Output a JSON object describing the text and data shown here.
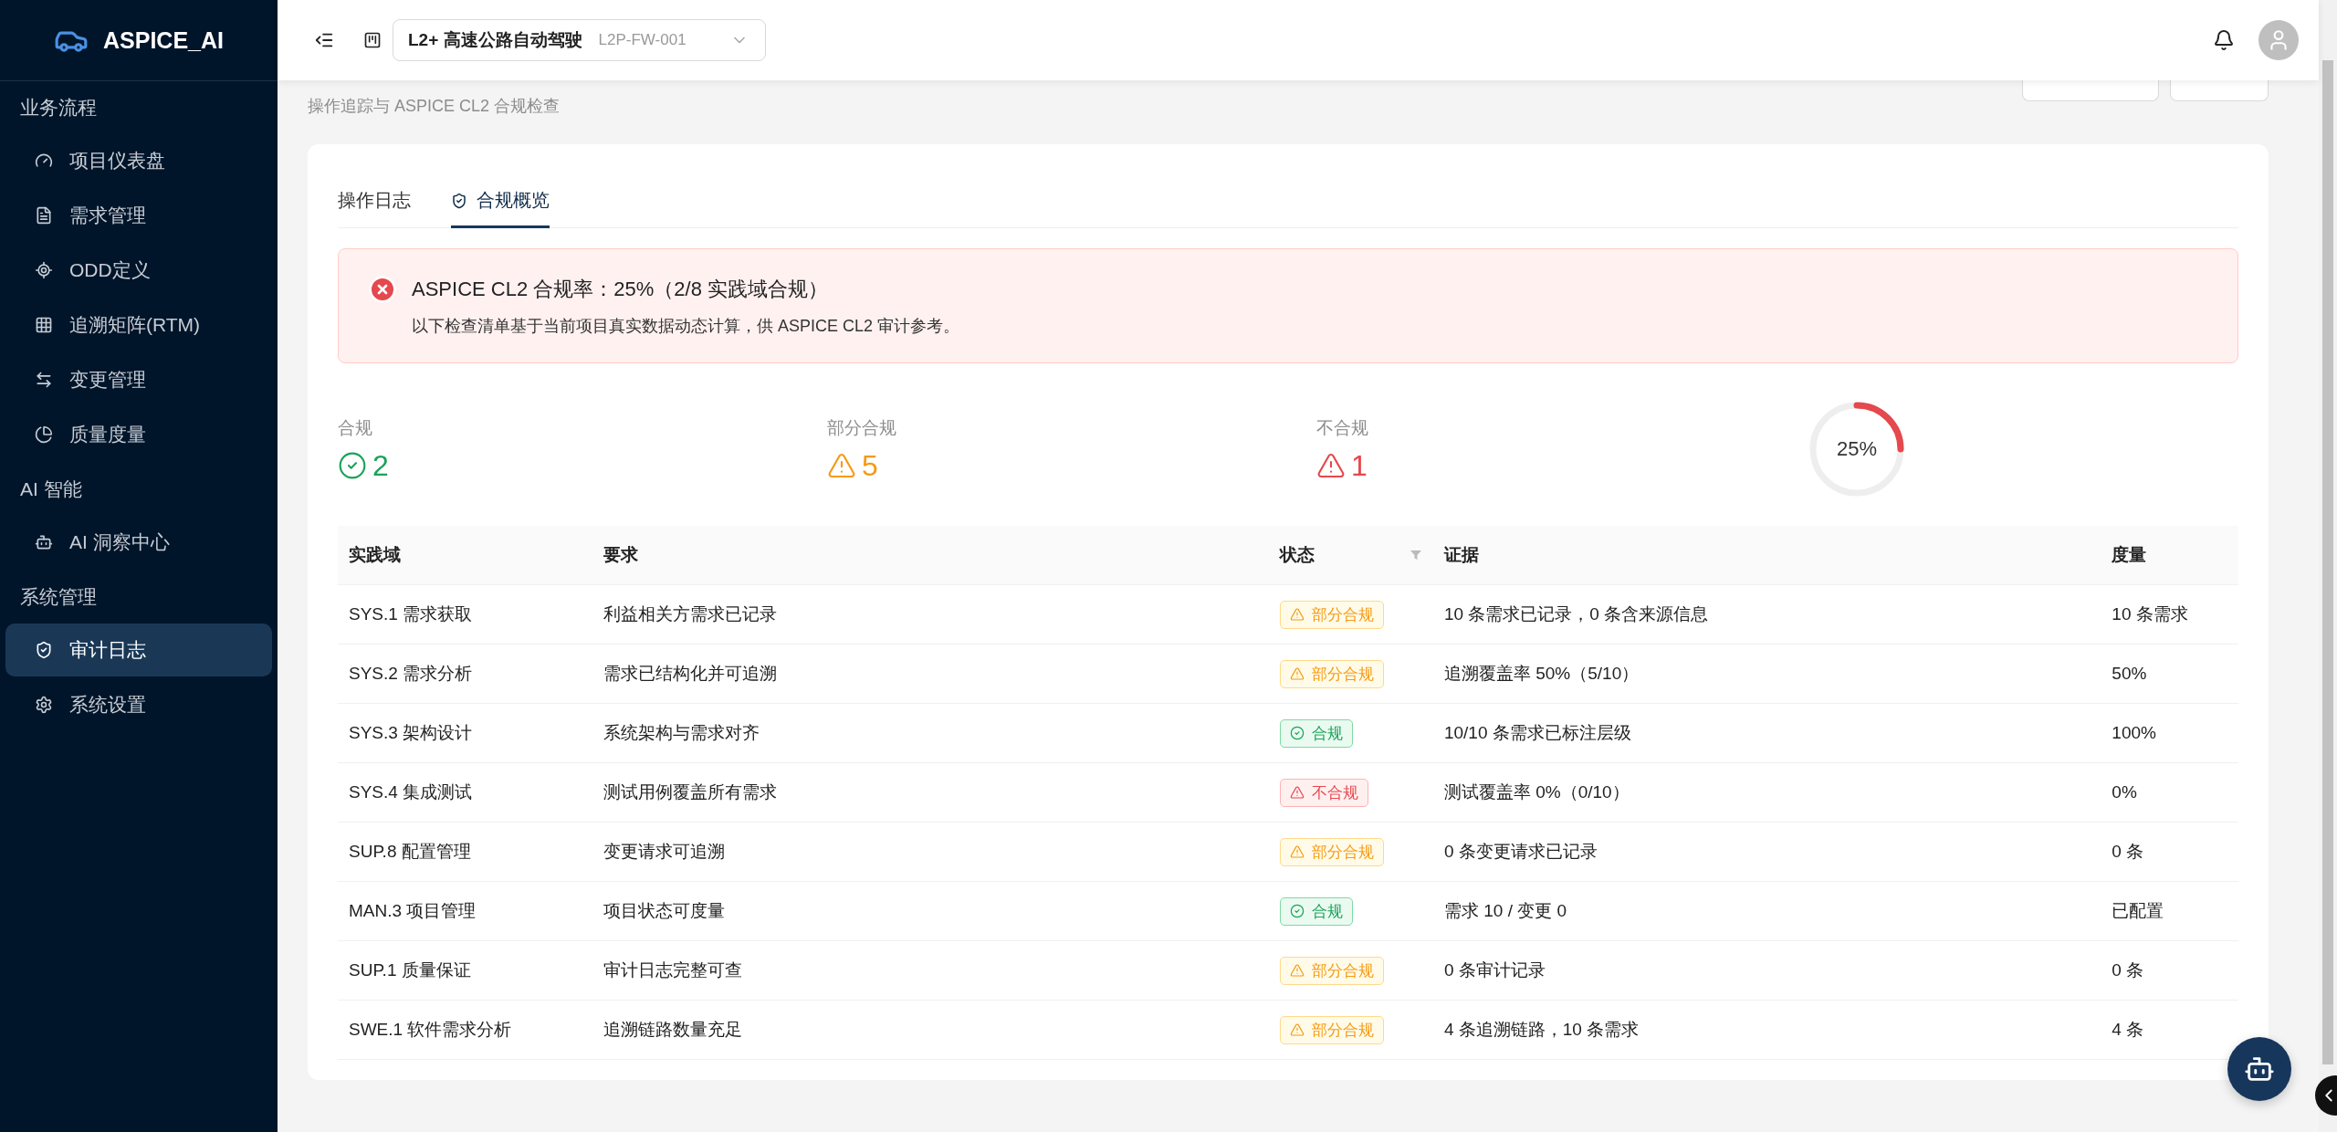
{
  "sidebar": {
    "logo": "ASPICE_AI",
    "items": [
      {
        "kind": "group",
        "label": "业务流程"
      },
      {
        "kind": "item",
        "label": "项目仪表盘",
        "selected": false
      },
      {
        "kind": "item",
        "label": "需求管理",
        "selected": false
      },
      {
        "kind": "item",
        "label": "ODD定义",
        "selected": false
      },
      {
        "kind": "item",
        "label": "追溯矩阵(RTM)",
        "selected": false
      },
      {
        "kind": "item",
        "label": "变更管理",
        "selected": false
      },
      {
        "kind": "item",
        "label": "质量度量",
        "selected": false
      },
      {
        "kind": "group",
        "label": "AI 智能"
      },
      {
        "kind": "item",
        "label": "AI 洞察中心",
        "selected": false
      },
      {
        "kind": "group",
        "label": "系统管理"
      },
      {
        "kind": "item",
        "label": "审计日志",
        "selected": true
      },
      {
        "kind": "item",
        "label": "系统设置",
        "selected": false
      }
    ]
  },
  "header": {
    "project": {
      "name": "L2+ 高速公路自动驾驶",
      "code": "L2P-FW-001"
    }
  },
  "page": {
    "subtitle": "操作追踪与 ASPICE CL2 合规检查"
  },
  "tabs": [
    {
      "label": "操作日志",
      "selected": false
    },
    {
      "label": "合规概览",
      "selected": true
    }
  ],
  "alert": {
    "title": "ASPICE CL2 合规率：25%（2/8 实践域合规）",
    "message": "以下检查清单基于当前项目真实数据动态计算，供 ASPICE CL2 审计参考。"
  },
  "stats": [
    {
      "kind": "pass",
      "label": "合规",
      "value": "2"
    },
    {
      "kind": "partial",
      "label": "部分合规",
      "value": "5"
    },
    {
      "kind": "fail",
      "label": "不合规",
      "value": "1"
    }
  ],
  "progress": {
    "level": 0.25,
    "reading": "25%"
  },
  "table": {
    "columns": [
      "实践域",
      "要求",
      "状态",
      "证据",
      "度量"
    ],
    "rows": [
      {
        "domain": "SYS.1 需求获取",
        "requirement": "利益相关方需求已记录",
        "kind": "partial",
        "status_label": "部分合规",
        "evidence": "10 条需求已记录，0 条含来源信息",
        "metric": "10 条需求"
      },
      {
        "domain": "SYS.2 需求分析",
        "requirement": "需求已结构化并可追溯",
        "kind": "partial",
        "status_label": "部分合规",
        "evidence": "追溯覆盖率 50%（5/10）",
        "metric": "50%"
      },
      {
        "domain": "SYS.3 架构设计",
        "requirement": "系统架构与需求对齐",
        "kind": "pass",
        "status_label": "合规",
        "evidence": "10/10 条需求已标注层级",
        "metric": "100%"
      },
      {
        "domain": "SYS.4 集成测试",
        "requirement": "测试用例覆盖所有需求",
        "kind": "fail",
        "status_label": "不合规",
        "evidence": "测试覆盖率 0%（0/10）",
        "metric": "0%"
      },
      {
        "domain": "SUP.8 配置管理",
        "requirement": "变更请求可追溯",
        "kind": "partial",
        "status_label": "部分合规",
        "evidence": "0 条变更请求已记录",
        "metric": "0 条"
      },
      {
        "domain": "MAN.3 项目管理",
        "requirement": "项目状态可度量",
        "kind": "pass",
        "status_label": "合规",
        "evidence": "需求 10 / 变更 0",
        "metric": "已配置"
      },
      {
        "domain": "SUP.1 质量保证",
        "requirement": "审计日志完整可查",
        "kind": "partial",
        "status_label": "部分合规",
        "evidence": "0 条审计记录",
        "metric": "0 条"
      },
      {
        "domain": "SWE.1 软件需求分析",
        "requirement": "追溯链路数量充足",
        "kind": "partial",
        "status_label": "部分合规",
        "evidence": "4 条追溯链路，10 条需求",
        "metric": "4 条"
      }
    ]
  }
}
